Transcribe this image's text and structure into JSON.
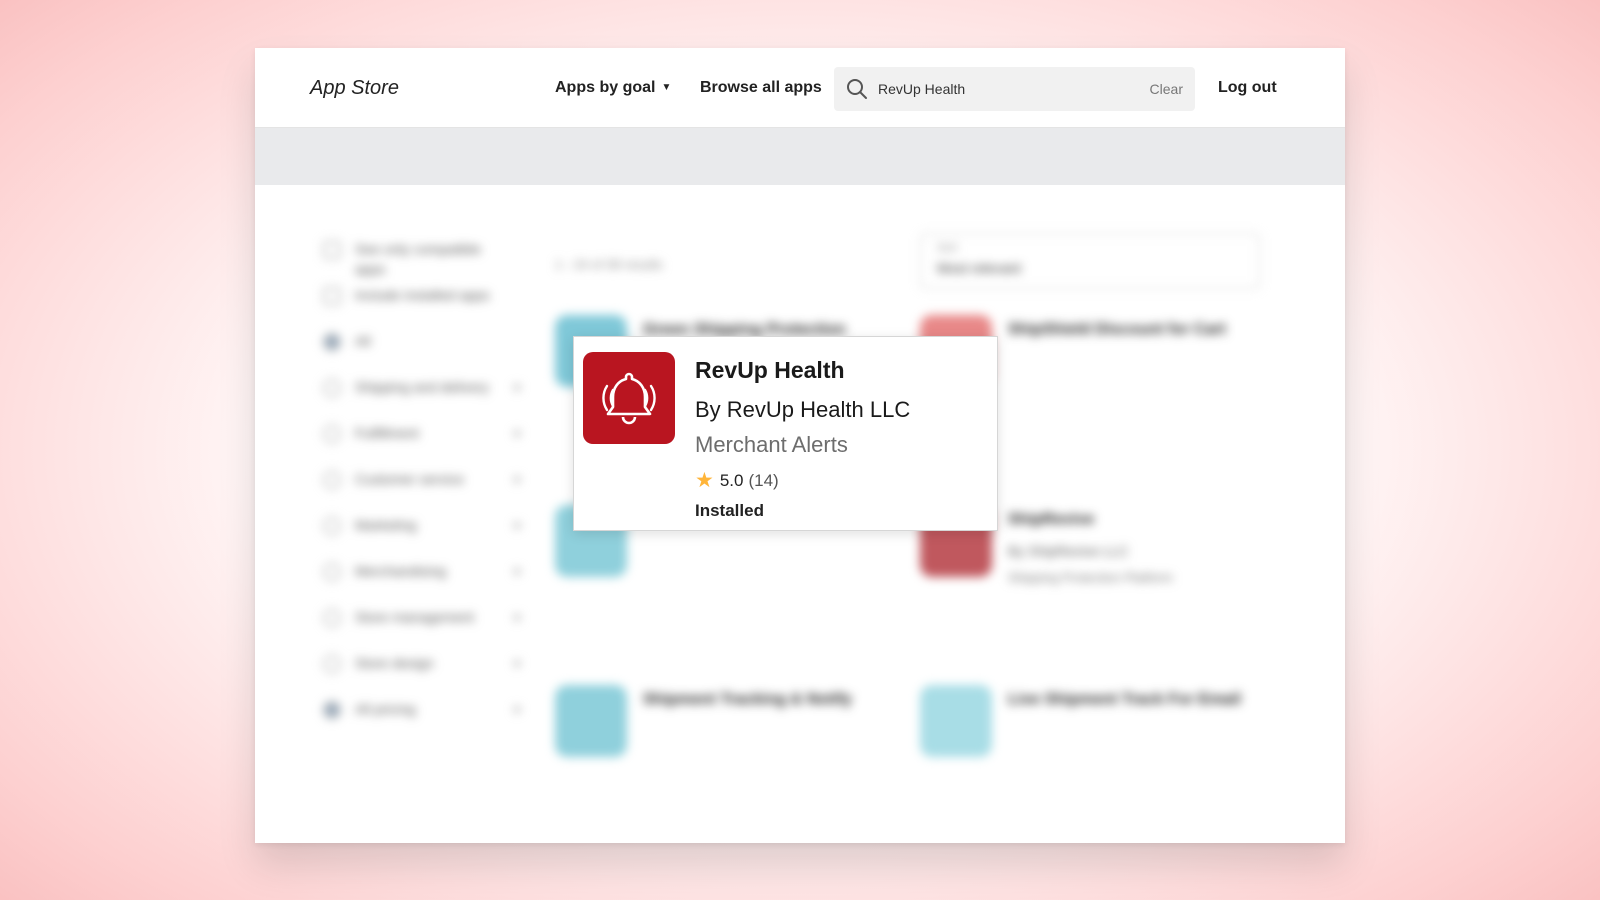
{
  "header": {
    "brand": "App Store",
    "nav_apps_by_goal": "Apps by goal",
    "nav_browse_all": "Browse all apps",
    "search_value": "RevUp Health",
    "search_clear": "Clear",
    "logout": "Log out"
  },
  "popup": {
    "app_name": "RevUp Health",
    "developer": "By RevUp Health LLC",
    "category": "Merchant Alerts",
    "rating": "5.0",
    "rating_count": "(14)",
    "status": "Installed",
    "icon": "bell-ringing-icon",
    "icon_color": "#b91520",
    "star_color": "#ffb53a"
  },
  "background_blurred": {
    "filters": [
      {
        "label": "See only compatible apps"
      },
      {
        "label": "Include installed apps"
      },
      {
        "label": "All"
      },
      {
        "label": "Shipping and delivery"
      },
      {
        "label": "Fulfillment"
      },
      {
        "label": "Customer service"
      },
      {
        "label": "Marketing"
      },
      {
        "label": "Merchandising"
      },
      {
        "label": "Store management"
      },
      {
        "label": "Store design"
      },
      {
        "label": "All pricing"
      }
    ],
    "results_count": "1 - 24 of 38 results",
    "sort_label": "Sort",
    "sort_value": "Most relevant",
    "cards": [
      {
        "title": "Green Shipping Protection",
        "by": "",
        "desc": ""
      },
      {
        "title": "ShipShield Discount for Cart",
        "by": "",
        "desc": ""
      },
      {
        "title": "",
        "by": "",
        "desc": ""
      },
      {
        "title": "ShipRevive",
        "by": "By ShipRevive LLC",
        "desc": "Shipping Protection Platform"
      },
      {
        "title": "Shipment Tracking & Notify",
        "by": "",
        "desc": ""
      },
      {
        "title": "Live Shipment Track For Email",
        "by": "",
        "desc": ""
      }
    ]
  }
}
